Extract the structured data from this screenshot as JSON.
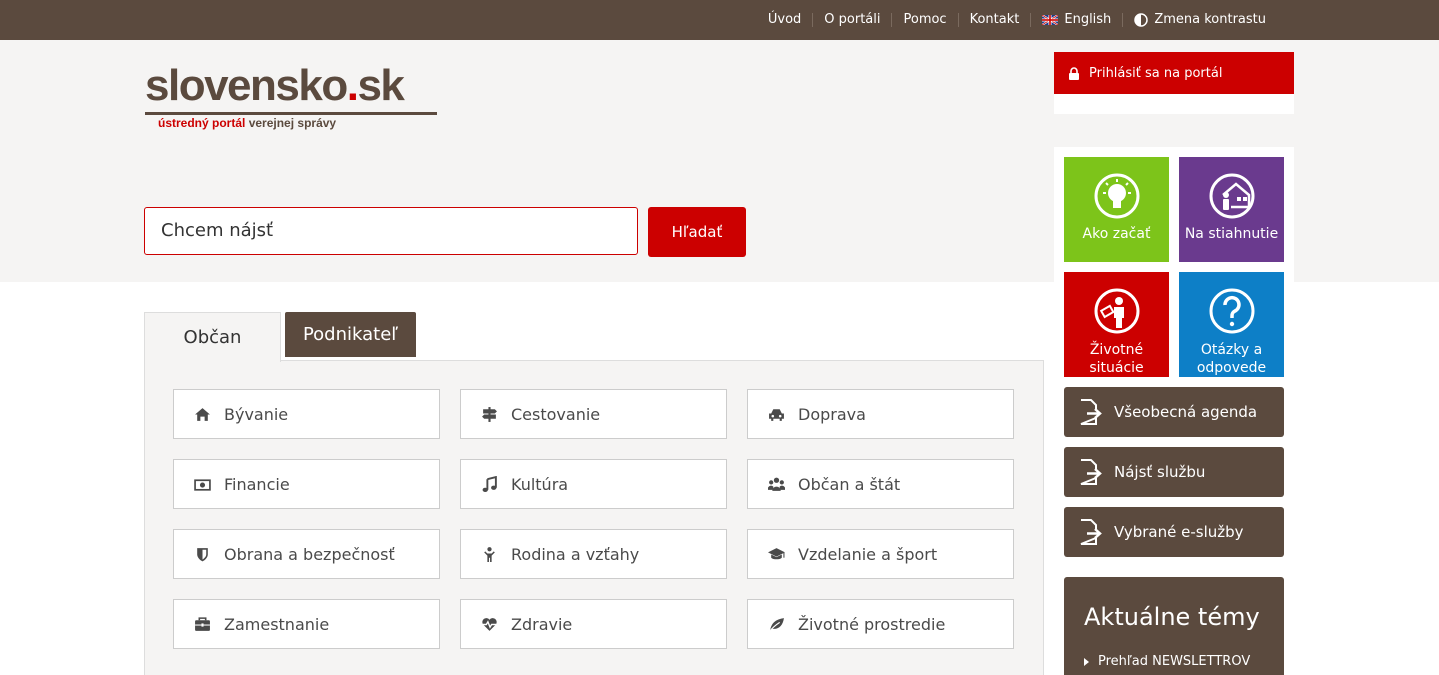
{
  "topnav": {
    "items": [
      "Úvod",
      "O portáli",
      "Pomoc",
      "Kontakt"
    ],
    "english": "English",
    "contrast": "Zmena kontrastu"
  },
  "logo": {
    "main_before_dot": "slovensko",
    "dot": ".",
    "main_after_dot": "sk",
    "sub_red": "ústredný portál",
    "sub_brown": "verejnej správy"
  },
  "search": {
    "placeholder": "Chcem nájsť",
    "button": "Hľadať"
  },
  "login": {
    "label": "Prihlásiť sa na portál"
  },
  "tiles": {
    "ako_zacat": "Ako začať",
    "na_stiahnutie": "Na stiahnutie",
    "zivotne_1": "Životné",
    "zivotne_2": "situácie",
    "otazky_1": "Otázky a",
    "otazky_2": "odpovede"
  },
  "side_buttons": [
    "Všeobecná agenda",
    "Nájsť službu",
    "Vybrané e-služby"
  ],
  "topics": {
    "title": "Aktuálne témy",
    "link": "Prehľad NEWSLETTROV"
  },
  "tabs": {
    "active": "Občan",
    "inactive": "Podnikateľ"
  },
  "categories": [
    {
      "label": "Bývanie",
      "icon": "home-icon"
    },
    {
      "label": "Cestovanie",
      "icon": "signpost-icon"
    },
    {
      "label": "Doprava",
      "icon": "car-icon"
    },
    {
      "label": "Financie",
      "icon": "money-icon"
    },
    {
      "label": "Kultúra",
      "icon": "music-icon"
    },
    {
      "label": "Občan a štát",
      "icon": "users-icon"
    },
    {
      "label": "Obrana a bezpečnosť",
      "icon": "shield-icon"
    },
    {
      "label": "Rodina a vzťahy",
      "icon": "child-icon"
    },
    {
      "label": "Vzdelanie a šport",
      "icon": "graduation-cap-icon"
    },
    {
      "label": "Zamestnanie",
      "icon": "briefcase-icon"
    },
    {
      "label": "Zdravie",
      "icon": "heartbeat-icon"
    },
    {
      "label": "Životné prostredie",
      "icon": "leaf-icon"
    }
  ],
  "colors": {
    "brown": "#5b4a3e",
    "red": "#cc0000",
    "green": "#7dc41a",
    "purple": "#6a3a8e",
    "blue": "#0d7fc7"
  }
}
